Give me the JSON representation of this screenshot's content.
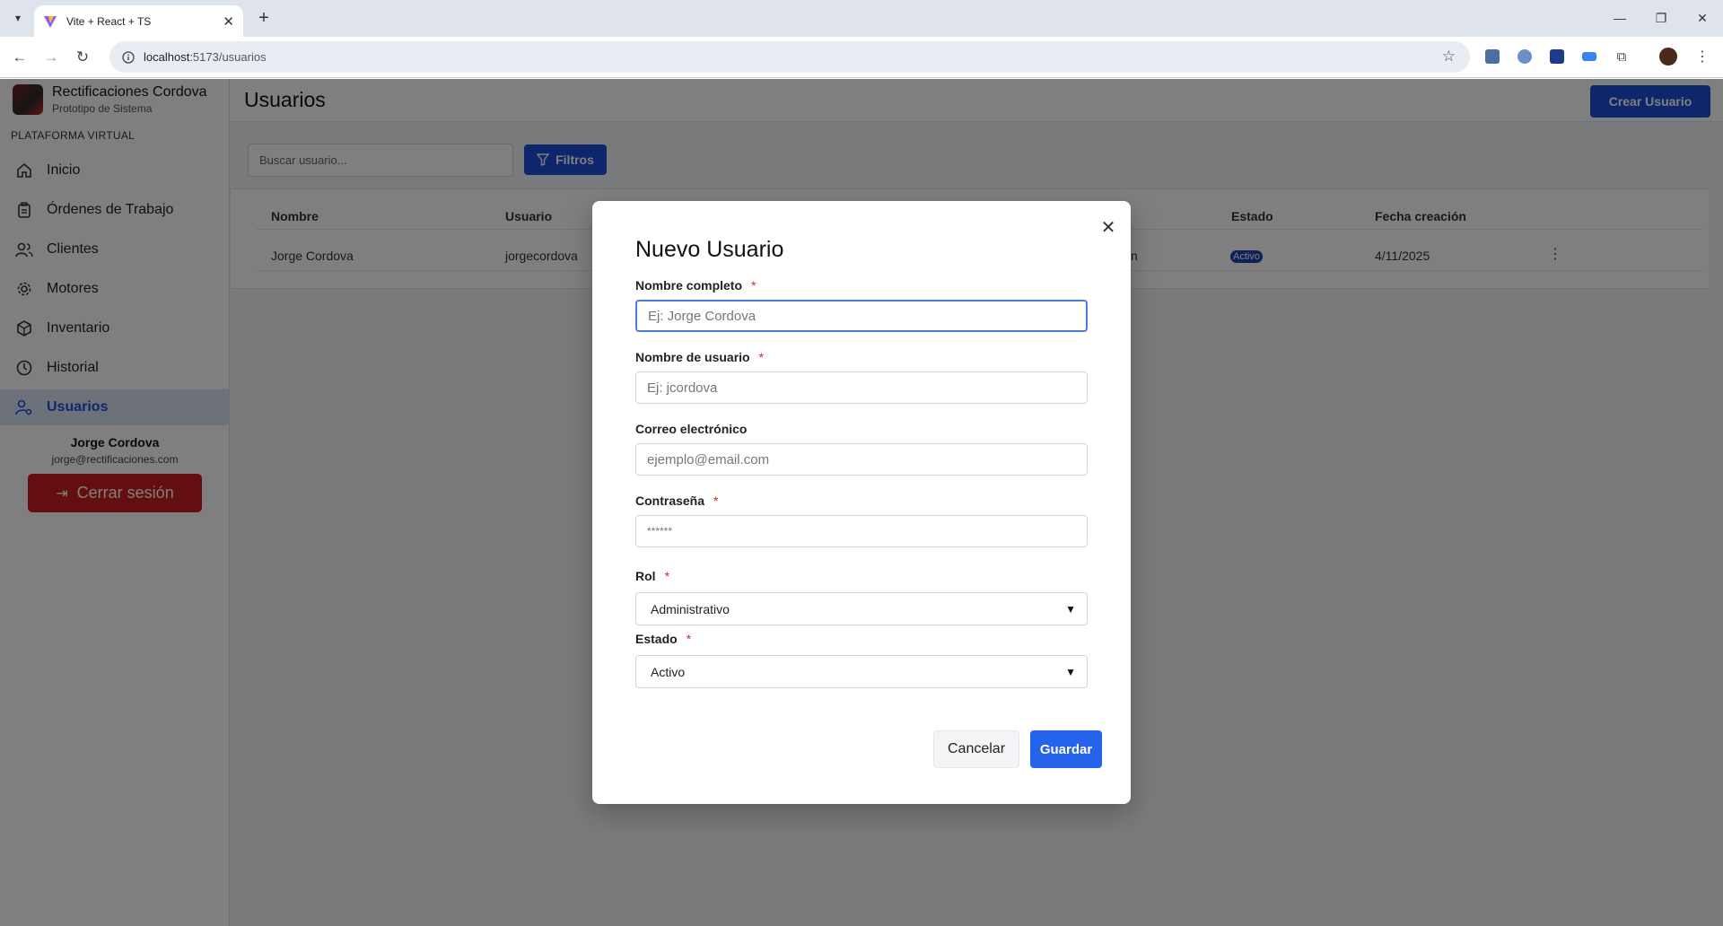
{
  "browser": {
    "tab_title": "Vite + React + TS",
    "url_host": "localhost",
    "url_rest": ":5173/usuarios"
  },
  "sidebar": {
    "brand_title": "Rectificaciones Cordova",
    "brand_subtitle": "Prototipo de Sistema",
    "section_label": "PLATAFORMA VIRTUAL",
    "items": [
      {
        "label": "Inicio",
        "icon": "home-icon"
      },
      {
        "label": "Órdenes de Trabajo",
        "icon": "clipboard-icon"
      },
      {
        "label": "Clientes",
        "icon": "users-icon"
      },
      {
        "label": "Motores",
        "icon": "gear-icon"
      },
      {
        "label": "Inventario",
        "icon": "box-icon"
      },
      {
        "label": "Historial",
        "icon": "clock-icon"
      },
      {
        "label": "Usuarios",
        "icon": "user-cog-icon",
        "active": true
      }
    ],
    "user_name": "Jorge Cordova",
    "user_email": "jorge@rectificaciones.com",
    "logout_label": "Cerrar sesión"
  },
  "main": {
    "title": "Usuarios",
    "create_button": "Crear Usuario",
    "search_placeholder": "Buscar usuario...",
    "filter_button": "Filtros",
    "table": {
      "headers": {
        "nombre": "Nombre",
        "usuario": "Usuario",
        "estado": "Estado",
        "fecha": "Fecha creación"
      },
      "rows": [
        {
          "nombre": "Jorge Cordova",
          "usuario": "jorgecordova",
          "partial": "n",
          "estado": "Activo",
          "fecha": "4/11/2025"
        }
      ]
    }
  },
  "modal": {
    "title": "Nuevo Usuario",
    "fields": {
      "nombre": {
        "label": "Nombre completo",
        "placeholder": "Ej: Jorge Cordova"
      },
      "usuario": {
        "label": "Nombre de usuario",
        "placeholder": "Ej: jcordova"
      },
      "correo": {
        "label": "Correo electrónico",
        "placeholder": "ejemplo@email.com"
      },
      "password": {
        "label": "Contraseña",
        "placeholder": "******"
      },
      "rol": {
        "label": "Rol",
        "value": "Administrativo"
      },
      "estado": {
        "label": "Estado",
        "value": "Activo"
      }
    },
    "required_mark": "*",
    "cancel_button": "Cancelar",
    "save_button": "Guardar"
  }
}
